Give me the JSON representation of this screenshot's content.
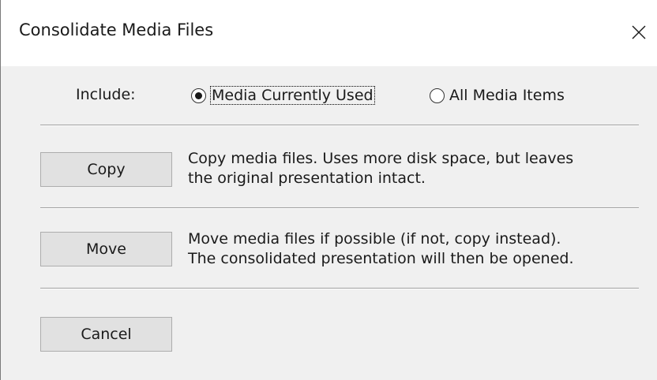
{
  "window": {
    "title": "Consolidate Media Files",
    "close_glyph": "✕"
  },
  "include": {
    "label": "Include:",
    "options": [
      {
        "label": "Media Currently Used",
        "selected": true
      },
      {
        "label": "All Media Items",
        "selected": false
      }
    ]
  },
  "actions": {
    "copy": {
      "button_label": "Copy",
      "description_line1": "Copy media files. Uses more disk space, but leaves",
      "description_line2": "the original presentation intact."
    },
    "move": {
      "button_label": "Move",
      "description_line1": "Move media files if possible (if not, copy instead).",
      "description_line2": "The consolidated presentation will then be opened."
    },
    "cancel": {
      "button_label": "Cancel"
    }
  },
  "icons": {
    "close": "close-icon",
    "radio_selected": "radio-selected-icon",
    "radio_unselected": "radio-unselected-icon"
  },
  "colors": {
    "dialog_background": "#f0f0f0",
    "titlebar_background": "#ffffff",
    "button_background": "#e1e1e1",
    "button_border": "#adadad",
    "text": "#1a1a1a"
  }
}
